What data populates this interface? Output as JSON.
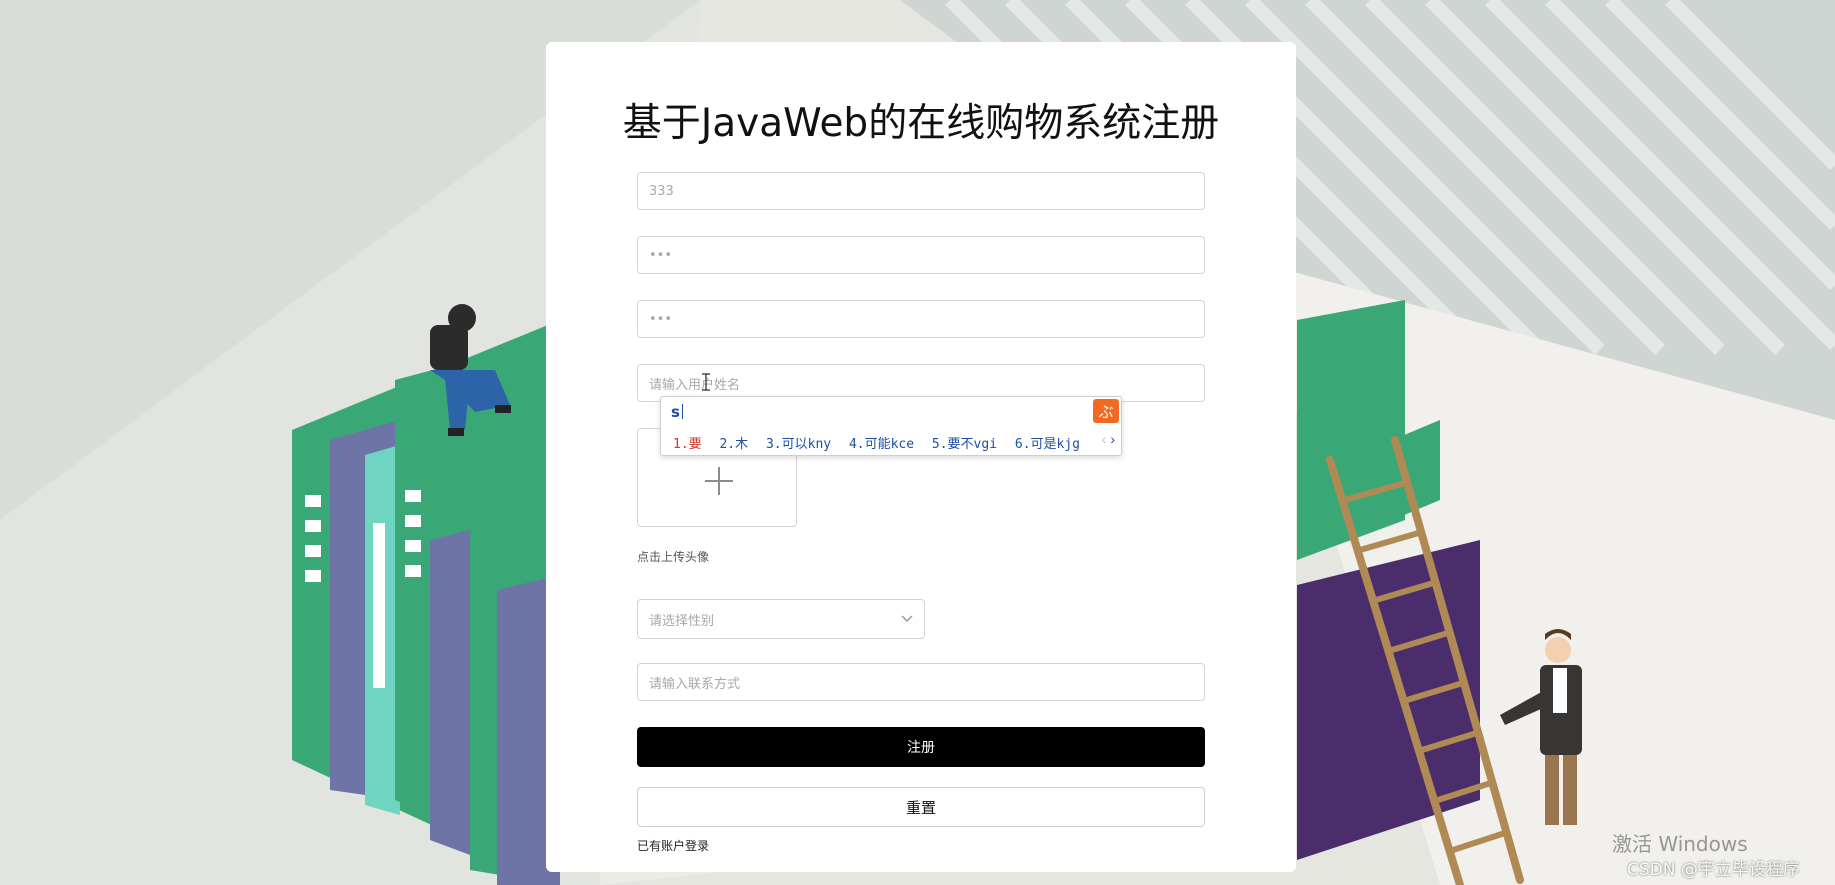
{
  "page": {
    "title": "基于JavaWeb的在线购物系统注册"
  },
  "form": {
    "username_value": "333",
    "password_value": "•••",
    "confirm_password_value": "•••",
    "realname_placeholder": "请输入用户姓名",
    "upload_hint": "点击上传头像",
    "gender_placeholder": "请选择性别",
    "contact_placeholder": "请输入联系方式",
    "register_label": "注册",
    "reset_label": "重置",
    "login_link": "已有账户登录"
  },
  "ime": {
    "input": "s",
    "logo": "ぶ",
    "candidates": [
      "1.要",
      "2.木",
      "3.可以kny",
      "4.可能kce",
      "5.要不vgi",
      "6.可是kjg"
    ],
    "prev": "‹",
    "next": "›"
  },
  "watermark": {
    "activate": "激活 Windows",
    "credit": "CSDN @宇立毕设程序"
  },
  "colors": {
    "book_green": "#3aa876",
    "book_purple": "#4b2d6b",
    "book_slate": "#6f74a6",
    "button_black": "#000000",
    "ime_orange": "#f26a21"
  }
}
